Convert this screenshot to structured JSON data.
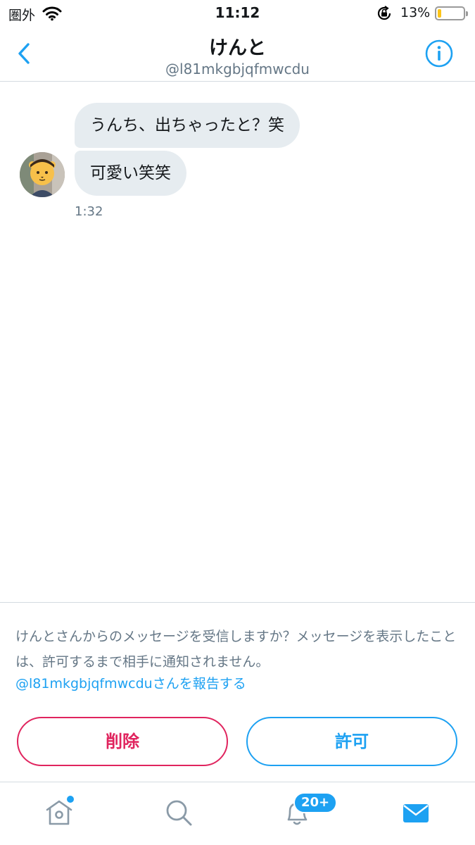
{
  "status_bar": {
    "carrier": "圏外",
    "time": "11:12",
    "battery_percent": "13%",
    "battery_level": 0.13,
    "battery_color": "#fcc419"
  },
  "header": {
    "title": "けんと",
    "handle": "@l81mkgbjqfmwcdu",
    "back_icon": "chevron-left-icon",
    "info_icon": "info-icon"
  },
  "conversation": {
    "messages": [
      {
        "text": "うんち、出ちゃったと？笑"
      },
      {
        "text": "可愛い笑笑"
      }
    ],
    "timestamp": "1:32"
  },
  "request": {
    "prompt": "けんとさんからのメッセージを受信しますか？メッセージを表示したことは、許可するまで相手に通知されません。",
    "report_link": "@l81mkgbjqfmwcduさんを報告する",
    "delete_label": "削除",
    "allow_label": "許可"
  },
  "tab_bar": {
    "items": [
      {
        "name": "home",
        "icon": "home-icon",
        "has_dot": true
      },
      {
        "name": "search",
        "icon": "search-icon"
      },
      {
        "name": "notifications",
        "icon": "bell-icon",
        "badge": "20+"
      },
      {
        "name": "messages",
        "icon": "mail-icon",
        "active": true
      }
    ]
  },
  "colors": {
    "accent": "#1da1f2",
    "danger": "#e0245e",
    "bubble": "#e6ecf0",
    "secondary_text": "#657786",
    "inactive_icon": "#8a9aa7"
  }
}
